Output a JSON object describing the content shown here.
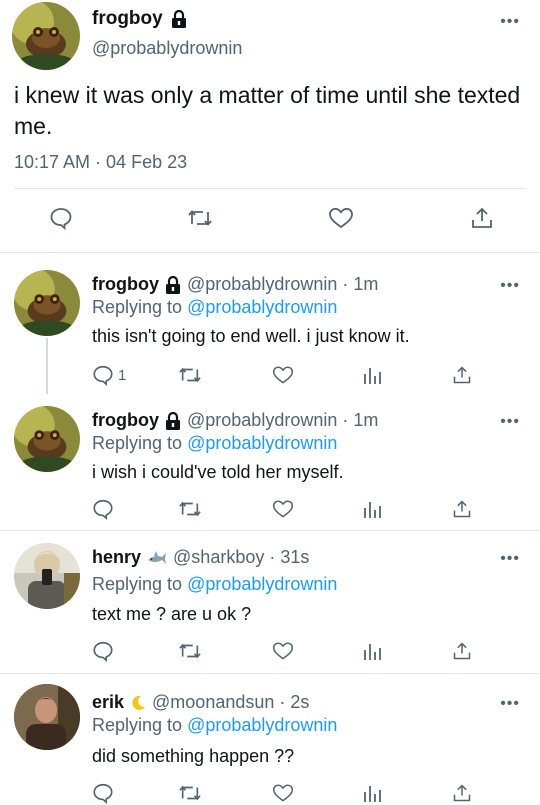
{
  "main_tweet": {
    "name": "frogboy",
    "handle": "@probablydrownin",
    "text": "i knew it was only a matter of time until she texted me.",
    "timestamp": "10:17 AM · 04 Feb 23",
    "more": "•••"
  },
  "replies": [
    {
      "name": "frogboy",
      "handle": "@probablydrownin · 1m",
      "replying_prefix": "Replying to",
      "replying_to": "@probablydrownin",
      "text": "this isn't going to end well. i just know it.",
      "reply_count": "1",
      "badge": "lock-icon"
    },
    {
      "name": "frogboy",
      "handle": "@probablydrownin · 1m",
      "replying_prefix": "Replying to",
      "replying_to": "@probablydrownin",
      "text": "i wish i could've told her myself.",
      "reply_count": "",
      "badge": "lock-icon"
    },
    {
      "name": "henry",
      "handle": "@sharkboy · 31s",
      "replying_prefix": "Replying to",
      "replying_to": "@probablydrownin",
      "text": "text me ? are u ok ?",
      "reply_count": "",
      "badge": "shark-emoji"
    },
    {
      "name": "erik",
      "handle": "@moonandsun · 2s",
      "replying_prefix": "Replying to",
      "replying_to": "@probablydrownin",
      "text": "did something happen ??",
      "reply_count": "",
      "badge": "crescent-moon-emoji"
    }
  ],
  "colors": {
    "text": "#0f1419",
    "secondary": "#536471",
    "link": "#1d9bf0",
    "divider": "#e1e8ed"
  }
}
